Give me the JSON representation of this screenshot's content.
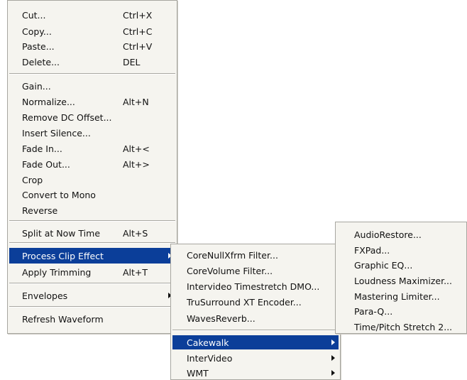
{
  "main_menu": {
    "items": [
      {
        "label": "Cut...",
        "shortcut": "Ctrl+X"
      },
      {
        "label": "Copy...",
        "shortcut": "Ctrl+C"
      },
      {
        "label": "Paste...",
        "shortcut": "Ctrl+V"
      },
      {
        "label": "Delete...",
        "shortcut": "DEL"
      },
      {
        "label": "Gain...",
        "shortcut": ""
      },
      {
        "label": "Normalize...",
        "shortcut": "Alt+N"
      },
      {
        "label": "Remove DC Offset...",
        "shortcut": ""
      },
      {
        "label": "Insert Silence...",
        "shortcut": ""
      },
      {
        "label": "Fade In...",
        "shortcut": "Alt+<"
      },
      {
        "label": "Fade Out...",
        "shortcut": "Alt+>"
      },
      {
        "label": "Crop",
        "shortcut": ""
      },
      {
        "label": "Convert to Mono",
        "shortcut": ""
      },
      {
        "label": "Reverse",
        "shortcut": ""
      },
      {
        "label": "Split at Now Time",
        "shortcut": "Alt+S"
      },
      {
        "label": "Process Clip Effect",
        "shortcut": "",
        "submenu": true,
        "highlighted": true
      },
      {
        "label": "Apply Trimming",
        "shortcut": "Alt+T"
      },
      {
        "label": "Envelopes",
        "shortcut": "",
        "submenu": true
      },
      {
        "label": "Refresh Waveform",
        "shortcut": ""
      }
    ]
  },
  "effects_submenu": {
    "items": [
      {
        "label": "CoreNullXfrm Filter..."
      },
      {
        "label": "CoreVolume Filter..."
      },
      {
        "label": "Intervideo Timestretch DMO..."
      },
      {
        "label": "TruSurround XT Encoder..."
      },
      {
        "label": "WavesReverb..."
      },
      {
        "label": "Cakewalk",
        "submenu": true,
        "highlighted": true
      },
      {
        "label": "InterVideo",
        "submenu": true
      },
      {
        "label": "WMT",
        "submenu": true
      }
    ]
  },
  "cakewalk_submenu": {
    "items": [
      {
        "label": "AudioRestore..."
      },
      {
        "label": "FXPad..."
      },
      {
        "label": "Graphic EQ..."
      },
      {
        "label": "Loudness Maximizer..."
      },
      {
        "label": "Mastering Limiter..."
      },
      {
        "label": "Para-Q..."
      },
      {
        "label": "Time/Pitch Stretch 2..."
      }
    ]
  },
  "colors": {
    "menu_background": "#f5f4ef",
    "highlight": "#0b3e99",
    "highlight_text": "#ffffff"
  }
}
